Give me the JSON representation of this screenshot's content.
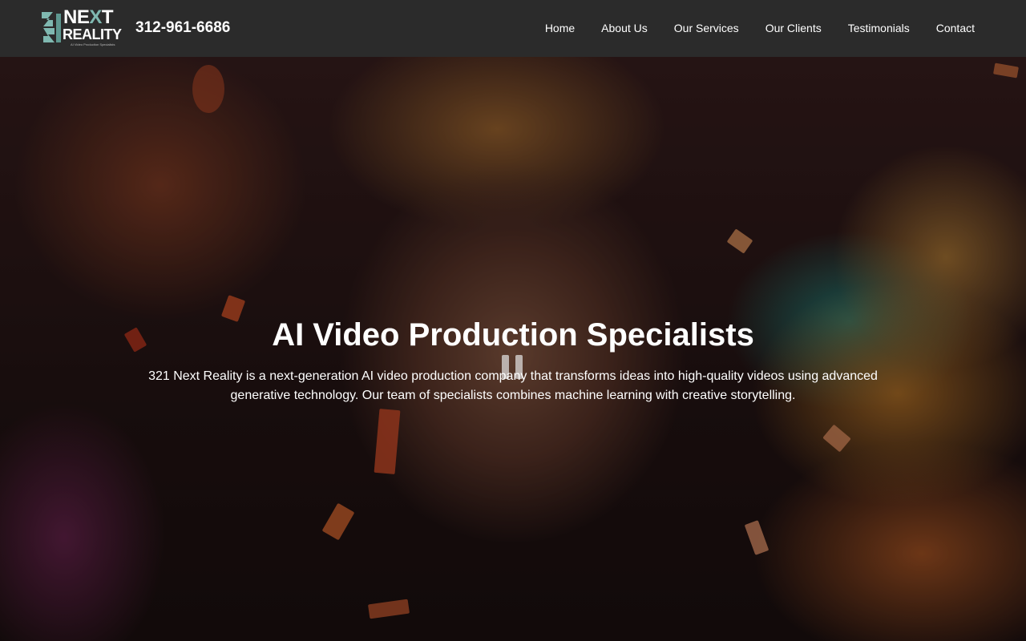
{
  "header": {
    "logo": {
      "prefix": "NE",
      "x_letter": "X",
      "suffix": "T",
      "line2": "REALITY",
      "tagline": "AI Video Production Specialists",
      "accent_color": "#7fb8b0"
    },
    "phone": "312-961-6686",
    "nav": [
      {
        "label": "Home"
      },
      {
        "label": "About Us"
      },
      {
        "label": "Our Services"
      },
      {
        "label": "Our Clients"
      },
      {
        "label": "Testimonials"
      },
      {
        "label": "Contact"
      }
    ],
    "background_color": "#2b2b2b"
  },
  "hero": {
    "title": "AI Video Production Specialists",
    "description": "321 Next Reality is a next-generation AI video production company that transforms ideas into high-quality videos using advanced generative technology. Our team of specialists combines machine learning with creative storytelling.",
    "video_control_icon": "pause-icon"
  }
}
